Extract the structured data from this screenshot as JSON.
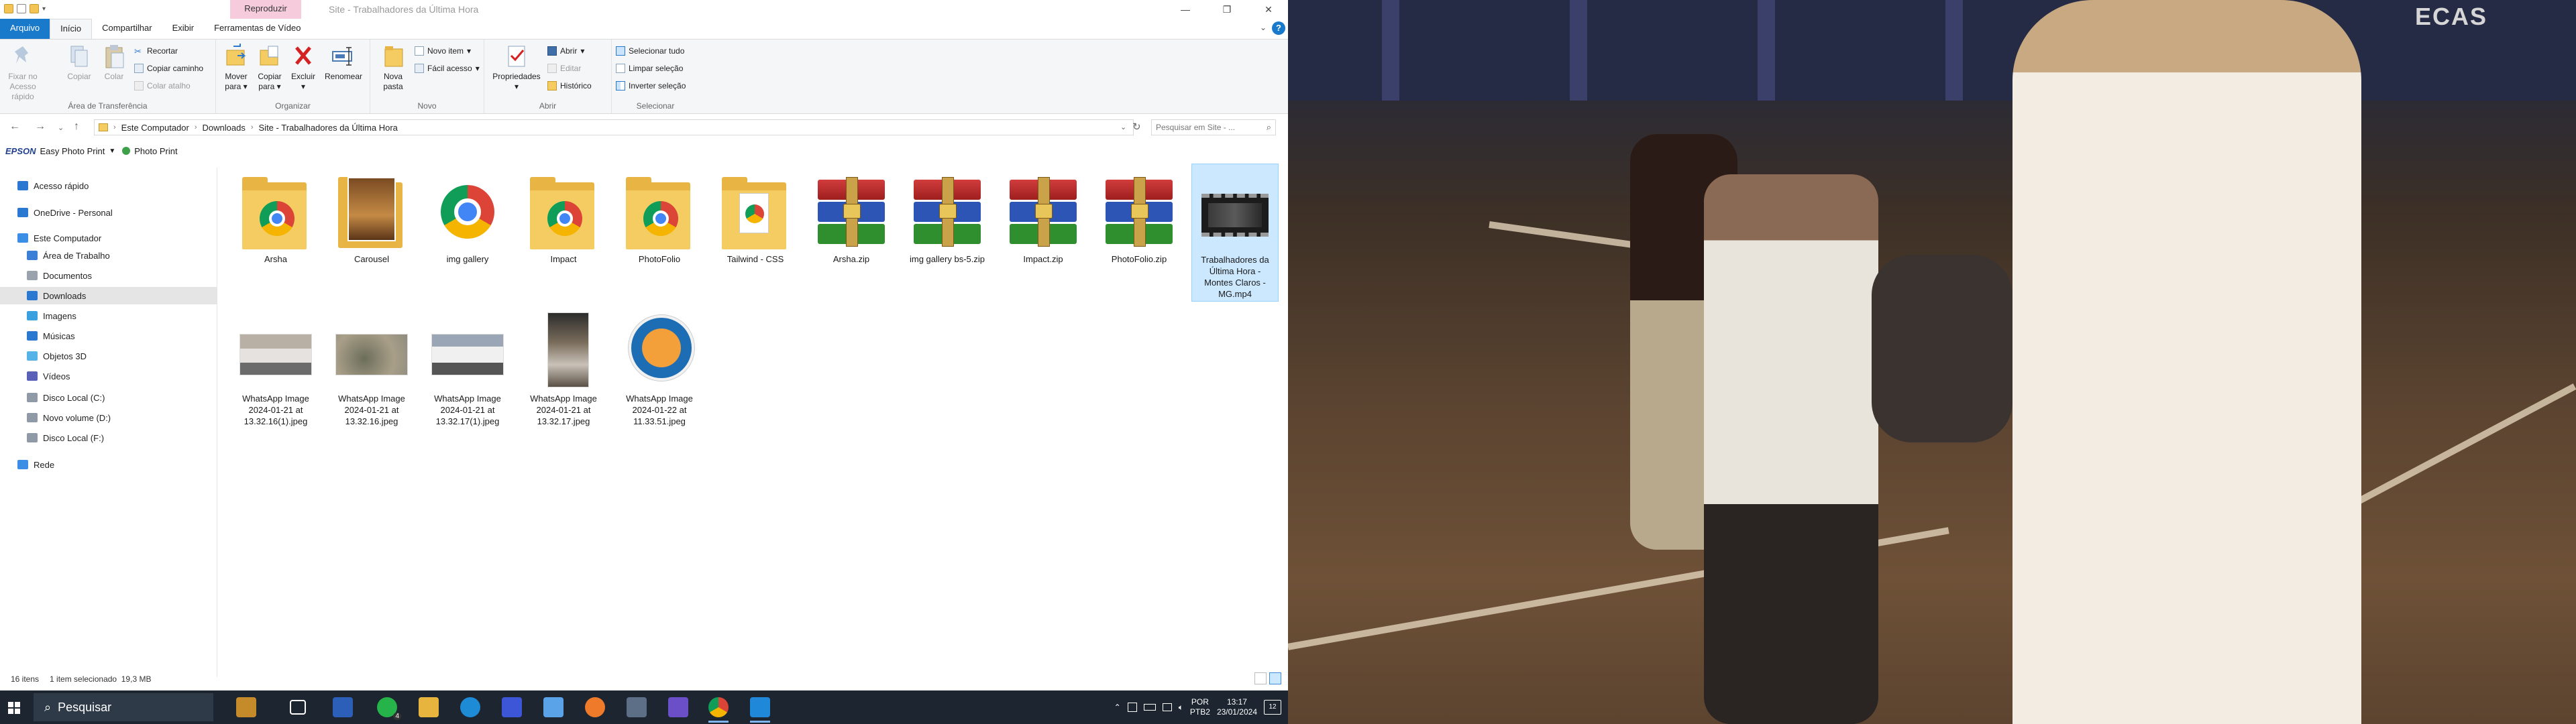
{
  "window": {
    "title": "Site - Trabalhadores da Última Hora",
    "contextual_tab_group": "Reproduzir"
  },
  "ribbon_tabs": [
    {
      "label": "Arquivo"
    },
    {
      "label": "Início"
    },
    {
      "label": "Compartilhar"
    },
    {
      "label": "Exibir"
    },
    {
      "label": "Ferramentas de Vídeo"
    }
  ],
  "ribbon": {
    "clipboard": {
      "pin_label_1": "Fixar no",
      "pin_label_2": "Acesso rápido",
      "copy": "Copiar",
      "paste": "Colar",
      "cut": "Recortar",
      "copy_path": "Copiar caminho",
      "paste_shortcut": "Colar atalho",
      "group": "Área de Transferência"
    },
    "organize": {
      "move_to_1": "Mover",
      "move_to_2": "para",
      "copy_to_1": "Copiar",
      "copy_to_2": "para",
      "delete": "Excluir",
      "rename": "Renomear",
      "group": "Organizar"
    },
    "new": {
      "new_folder_1": "Nova",
      "new_folder_2": "pasta",
      "new_item": "Novo item",
      "easy_access": "Fácil acesso",
      "group": "Novo"
    },
    "open": {
      "properties": "Propriedades",
      "open": "Abrir",
      "edit": "Editar",
      "history": "Histórico",
      "group": "Abrir"
    },
    "select": {
      "select_all": "Selecionar tudo",
      "select_none": "Limpar seleção",
      "invert": "Inverter seleção",
      "group": "Selecionar"
    }
  },
  "address": {
    "crumbs": [
      "Este Computador",
      "Downloads",
      "Site - Trabalhadores da Última Hora"
    ],
    "search_placeholder": "Pesquisar em Site - ..."
  },
  "epson": {
    "logo": "EPSON",
    "app": "Easy Photo Print",
    "photo_print": "Photo Print"
  },
  "sidebar": {
    "items": [
      {
        "label": "Acesso rápido",
        "icon": "star-icon",
        "color": "#2b78d0"
      },
      {
        "label": "OneDrive - Personal",
        "icon": "cloud-icon",
        "color": "#2b78d0"
      },
      {
        "label": "Este Computador",
        "icon": "computer-icon",
        "color": "#3a8ee6"
      },
      {
        "label": "Área de Trabalho",
        "icon": "desktop-icon",
        "color": "#3b7fd6"
      },
      {
        "label": "Documentos",
        "icon": "documents-icon",
        "color": "#9aa3ad"
      },
      {
        "label": "Downloads",
        "icon": "download-icon",
        "color": "#2b78d0"
      },
      {
        "label": "Imagens",
        "icon": "pictures-icon",
        "color": "#3aa0e0"
      },
      {
        "label": "Músicas",
        "icon": "music-icon",
        "color": "#2b78d0"
      },
      {
        "label": "Objetos 3D",
        "icon": "cube-icon",
        "color": "#56b3e8"
      },
      {
        "label": "Vídeos",
        "icon": "video-icon",
        "color": "#5a5fb8"
      },
      {
        "label": "Disco Local (C:)",
        "icon": "drive-icon",
        "color": "#8f9aa6"
      },
      {
        "label": "Novo volume (D:)",
        "icon": "drive-icon",
        "color": "#8f9aa6"
      },
      {
        "label": "Disco Local (F:)",
        "icon": "drive-icon",
        "color": "#8f9aa6"
      },
      {
        "label": "Rede",
        "icon": "network-icon",
        "color": "#3a8ee6"
      }
    ]
  },
  "files": [
    {
      "name": "Arsha",
      "kind": "folder-chrome"
    },
    {
      "name": "Carousel",
      "kind": "folder-photo"
    },
    {
      "name": "img gallery",
      "kind": "chrome"
    },
    {
      "name": "Impact",
      "kind": "folder-chrome"
    },
    {
      "name": "PhotoFolio",
      "kind": "folder-chrome"
    },
    {
      "name": "Tailwind - CSS",
      "kind": "folder-doc"
    },
    {
      "name": "Arsha.zip",
      "kind": "rar"
    },
    {
      "name": "img gallery bs-5.zip",
      "kind": "rar"
    },
    {
      "name": "Impact.zip",
      "kind": "rar"
    },
    {
      "name": "PhotoFolio.zip",
      "kind": "rar"
    },
    {
      "name": "Trabalhadores da Última Hora - Montes Claros - MG.mp4",
      "kind": "video"
    },
    {
      "name": "WhatsApp Image 2024-01-21 at 13.32.16(1).jpeg",
      "kind": "van"
    },
    {
      "name": "WhatsApp Image 2024-01-21 at 13.32.16.jpeg",
      "kind": "ruins"
    },
    {
      "name": "WhatsApp Image 2024-01-21 at 13.32.17(1).jpeg",
      "kind": "van2"
    },
    {
      "name": "WhatsApp Image 2024-01-21 at 13.32.17.jpeg",
      "kind": "person"
    },
    {
      "name": "WhatsApp Image 2024-01-22 at 11.33.51.jpeg",
      "kind": "logo"
    }
  ],
  "status": {
    "count": "16 itens",
    "selection": "1 item selecionado  19,3 MB"
  },
  "video": {
    "wall_sign": "ECAS"
  },
  "taskbar": {
    "search": "Pesquisar",
    "apps": [
      "file-manager-icon",
      "task-view-icon",
      "word-icon",
      "whatsapp-icon",
      "file-explorer-icon",
      "edge-icon",
      "app-icon",
      "explorer-icon",
      "firefox-icon",
      "calculator-icon",
      "media-icon",
      "chrome-icon",
      "vscode-icon"
    ],
    "whatsapp_badge": "4",
    "lang_1": "POR",
    "lang_2": "PTB2",
    "time": "13:17",
    "date": "23/01/2024",
    "notifications": "12"
  },
  "colors": {
    "accent": "#1979ca",
    "selection": "#cce8ff",
    "contextual": "#f6ccdc"
  }
}
